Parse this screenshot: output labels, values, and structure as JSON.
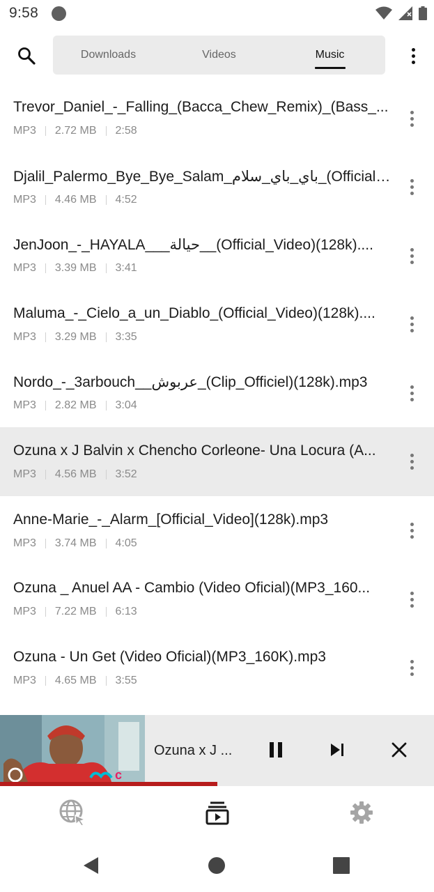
{
  "status_bar": {
    "time": "9:58",
    "icons": [
      "wifi-icon",
      "signal-icon",
      "battery-icon"
    ]
  },
  "header": {
    "search_icon": "search-icon",
    "tabs": [
      {
        "label": "Downloads",
        "active": false
      },
      {
        "label": "Videos",
        "active": false
      },
      {
        "label": "Music",
        "active": true
      }
    ],
    "more_icon": "more-vertical-icon"
  },
  "songs": [
    {
      "title": "Trevor_Daniel_-_Falling_(Bacca_Chew_Remix)_(Bass_...",
      "format": "MP3",
      "size": "2.72 MB",
      "duration": "2:58",
      "selected": false
    },
    {
      "title": "Djalil_Palermo_Bye_Bye_Salam_باي_باي_سلام_(Official_...",
      "format": "MP3",
      "size": "4.46 MB",
      "duration": "4:52",
      "selected": false
    },
    {
      "title": "JenJoon_-_HAYALA___حيالة__(Official_Video)(128k)....",
      "format": "MP3",
      "size": "3.39 MB",
      "duration": "3:41",
      "selected": false
    },
    {
      "title": "Maluma_-_Cielo_a_un_Diablo_(Official_Video)(128k)....",
      "format": "MP3",
      "size": "3.29 MB",
      "duration": "3:35",
      "selected": false
    },
    {
      "title": "Nordo_-_3arbouch__عربوش_(Clip_Officiel)(128k).mp3",
      "format": "MP3",
      "size": "2.82 MB",
      "duration": "3:04",
      "selected": false
    },
    {
      "title": "Ozuna x J Balvin x Chencho Corleone- Una Locura (A...",
      "format": "MP3",
      "size": "4.56 MB",
      "duration": "3:52",
      "selected": true
    },
    {
      "title": "Anne-Marie_-_Alarm_[Official_Video](128k).mp3",
      "format": "MP3",
      "size": "3.74 MB",
      "duration": "4:05",
      "selected": false
    },
    {
      "title": "Ozuna _ Anuel AA - Cambio (Video Oficial)(MP3_160...",
      "format": "MP3",
      "size": "7.22 MB",
      "duration": "6:13",
      "selected": false
    },
    {
      "title": "Ozuna - Un Get (Video Oficial)(MP3_160K).mp3",
      "format": "MP3",
      "size": "4.65 MB",
      "duration": "3:55",
      "selected": false
    }
  ],
  "player": {
    "title": "Ozuna x J ...",
    "progress": 0.5,
    "controls": [
      "pause-icon",
      "skip-next-icon",
      "close-icon"
    ]
  },
  "bottom_nav": [
    "browser-icon",
    "playlist-icon",
    "settings-icon"
  ],
  "system_nav": [
    "back-icon",
    "home-icon",
    "recents-icon"
  ],
  "colors": {
    "accent": "#b71c1c",
    "tab_bg": "#ebebeb",
    "selected_row": "#ebebeb",
    "meta_text": "#8a8a8a"
  }
}
